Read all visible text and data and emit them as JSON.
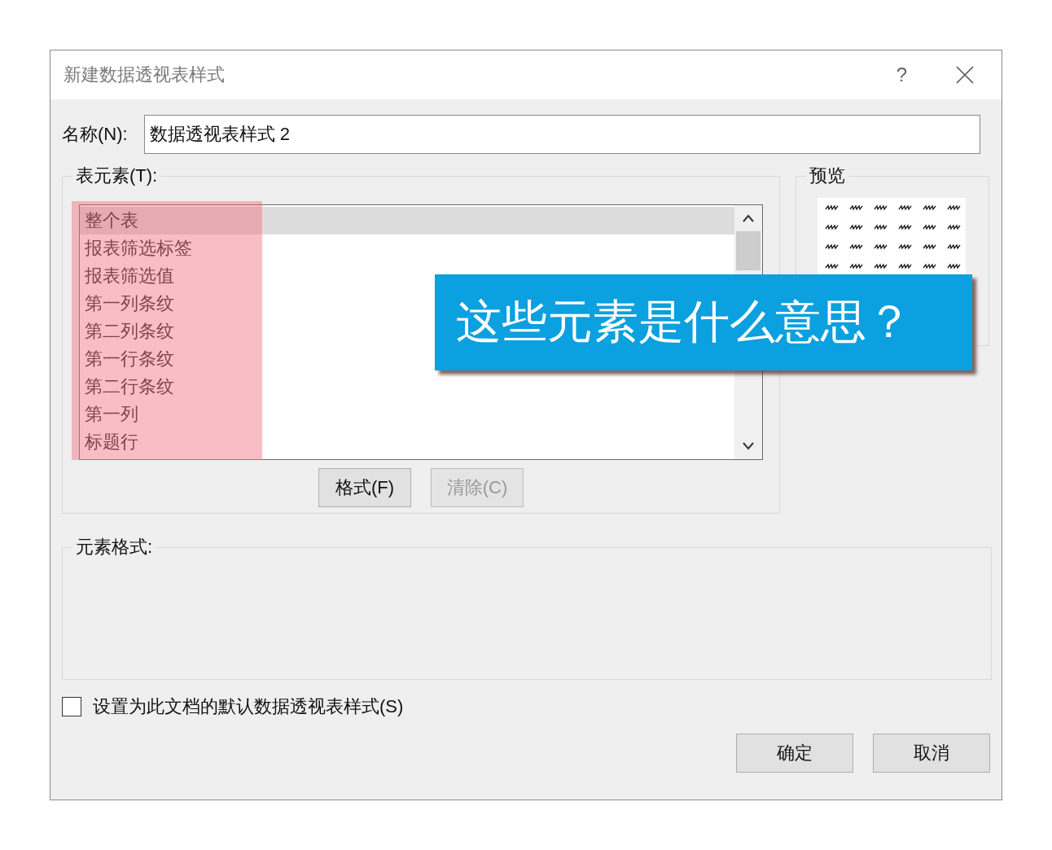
{
  "window": {
    "title": "新建数据透视表样式",
    "help": "?"
  },
  "name_field": {
    "label": "名称(N):",
    "value": "数据透视表样式 2"
  },
  "table_elements": {
    "label": "表元素(T):",
    "items": [
      {
        "label": "整个表",
        "selected": true
      },
      {
        "label": "报表筛选标签",
        "selected": false
      },
      {
        "label": "报表筛选值",
        "selected": false
      },
      {
        "label": "第一列条纹",
        "selected": false
      },
      {
        "label": "第二列条纹",
        "selected": false
      },
      {
        "label": "第一行条纹",
        "selected": false
      },
      {
        "label": "第二行条纹",
        "selected": false
      },
      {
        "label": "第一列",
        "selected": false
      },
      {
        "label": "标题行",
        "selected": false
      }
    ]
  },
  "element_buttons": [
    {
      "label": "格式(F)",
      "disabled": false
    },
    {
      "label": "清除(C)",
      "disabled": true
    }
  ],
  "preview": {
    "label": "预览"
  },
  "element_format": {
    "label": "元素格式:"
  },
  "default_checkbox": {
    "label": "设置为此文档的默认数据透视表样式(S)",
    "checked": false
  },
  "dialog_buttons": [
    "确定",
    "取消"
  ],
  "callout": {
    "text": "这些元素是什么意思？"
  }
}
